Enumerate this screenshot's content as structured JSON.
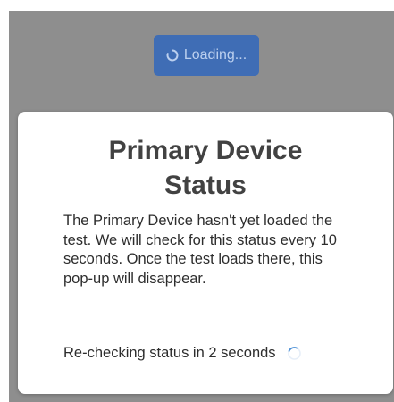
{
  "background_button": {
    "label": "Loading...",
    "icon": "spinner-icon",
    "color": "#3f6db5"
  },
  "modal": {
    "title": "Primary Device Status",
    "body": "The Primary Device hasn't yet loaded the test. We will check for this status every 10 seconds. Once the test loads there, this pop-up will disappear.",
    "recheck_text": "Re-checking status in 2 seconds",
    "recheck_icon": "spinner-icon"
  },
  "colors": {
    "backdrop": "#8e8e8e",
    "modal_background": "#ffffff",
    "title_text": "#424242"
  }
}
